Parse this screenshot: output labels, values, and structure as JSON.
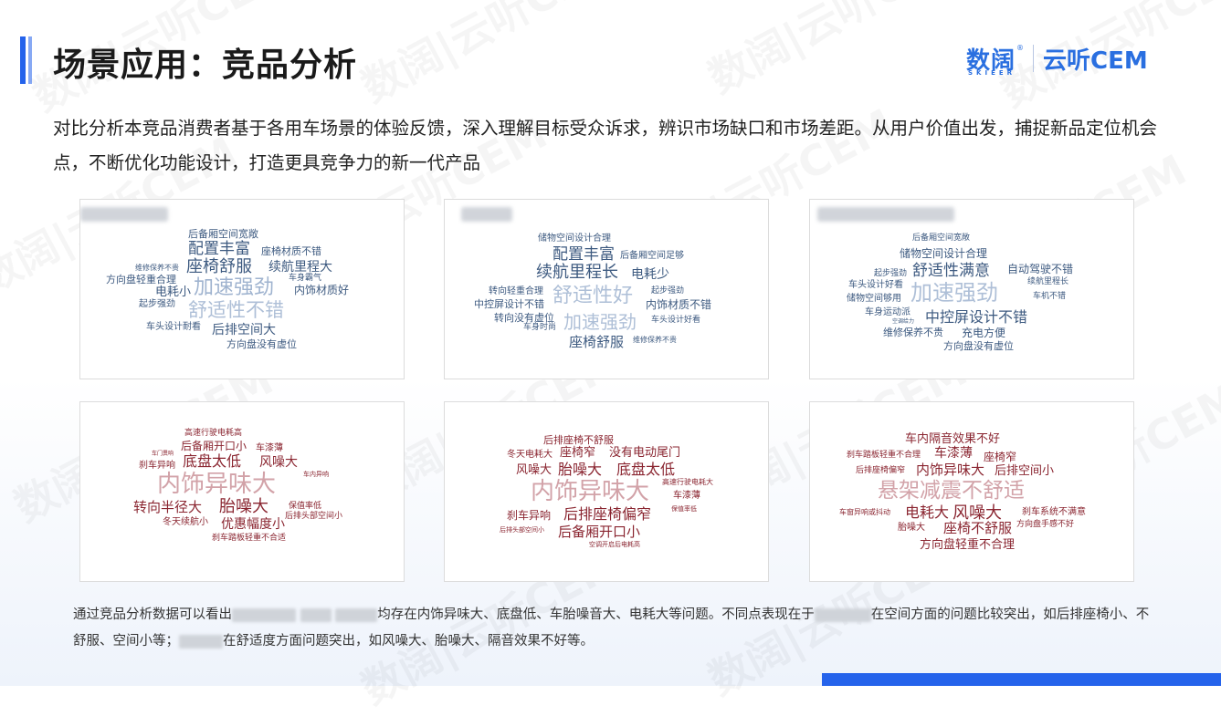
{
  "header": {
    "title": "场景应用：竞品分析",
    "logo": {
      "cn": "数阔",
      "reg_mark": "®",
      "sub": "SKIEER",
      "en": "云听CEM"
    }
  },
  "watermark": {
    "text": "数阔|云听CEM"
  },
  "intro": {
    "text": "对比分析本竞品消费者基于各用车场景的体验反馈，深入理解目标受众诉求，辨识市场缺口和市场差距。从用户价值出发，捕捉新品定位机会点，不断优化功能设计，打造更具竞争力的新一代产品"
  },
  "colors": {
    "accent": "#2563eb",
    "positive_words": "#3d5a80",
    "negative_words": "#8a2530"
  },
  "cards": {
    "positive": [
      {
        "words": [
          "后备厢空间宽敞",
          "配置丰富",
          "座椅材质不错",
          "维修保养不贵",
          "座椅舒服",
          "续航里程大",
          "方向盘轻重合理",
          "车身霸气",
          "电耗小",
          "加速强劲",
          "内饰材质好",
          "起步强劲",
          "舒适性不错",
          "车头设计耐看",
          "后排空间大",
          "方向盘没有虚位"
        ]
      },
      {
        "words": [
          "储物空间设计合理",
          "配置丰富",
          "后备厢空间足够",
          "续航里程长",
          "电耗少",
          "起步强劲",
          "转向轻重合理",
          "中控屏设计不错",
          "舒适性好",
          "内饰材质不错",
          "转向没有虚位",
          "车头设计好看",
          "加速强劲",
          "车身时尚",
          "座椅舒服",
          "维修保养不贵"
        ]
      },
      {
        "words": [
          "后备厢空间宽敞",
          "储物空间设计合理",
          "起步强劲",
          "舒适性满意",
          "自动驾驶不错",
          "续航里程长",
          "车头设计好看",
          "加速强劲",
          "车机不错",
          "储物空间够用",
          "车身运动派",
          "空调给力",
          "中控屏设计不错",
          "维修保养不贵",
          "充电方便",
          "方向盘没有虚位"
        ]
      }
    ],
    "negative": [
      {
        "words": [
          "高速行驶电耗高",
          "后备厢开口小",
          "车漆薄",
          "车门異响",
          "底盘太低",
          "风噪大",
          "刹车异响",
          "车内异响",
          "内饰异味大",
          "转向半径大",
          "胎噪大",
          "保值率低",
          "后排头部空间小",
          "冬天续航小",
          "优惠幅度小",
          "刹车踏板轻重不合适"
        ]
      },
      {
        "words": [
          "后排座椅不舒服",
          "冬天电耗大",
          "座椅窄",
          "没有电动尾门",
          "风噪大",
          "胎噪大",
          "底盘太低",
          "高速行驶电耗大",
          "内饰异味大",
          "车漆薄",
          "刹车异响",
          "后排座椅偏窄",
          "保值率低",
          "后排头部空间小",
          "后备厢开口小",
          "空调开启后电耗高"
        ]
      },
      {
        "words": [
          "车内隔音效果不好",
          "刹车踏板轻重不合理",
          "车漆薄",
          "座椅窄",
          "后排座椅偏窄",
          "内饰异味大",
          "后排空间小",
          "悬架减震不舒适",
          "车窗异响或抖动",
          "电耗大",
          "风噪大",
          "刹车系统不满意",
          "胎噪大",
          "座椅不舒服",
          "方向盘手感不好",
          "方向盘轻重不合理"
        ]
      }
    ]
  },
  "summary": {
    "part1": "通过竞品分析数据可以看出",
    "part2": "均存在内饰异味大、底盘低、车胎噪音大、电耗大等问题。不同点表现在于",
    "part3": "在空间方面的问题比较突出，如后排座椅小、不舒服、空间小等；",
    "part4": "在舒适度方面问题突出，如风噪大、胎噪大、隔音效果不好等。"
  }
}
